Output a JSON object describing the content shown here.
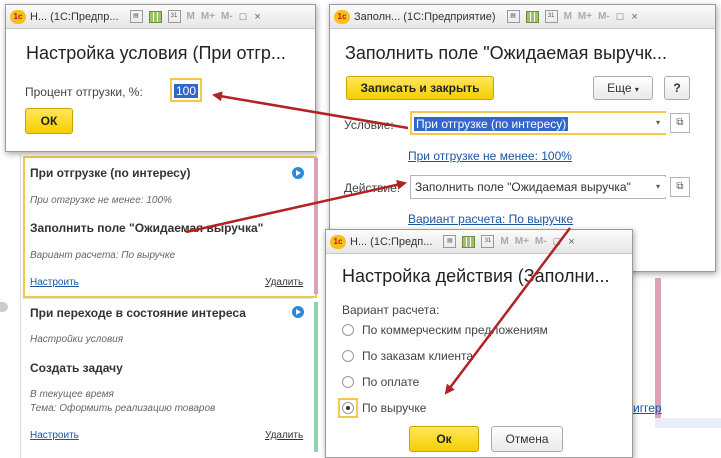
{
  "titlebar_glyphs": {
    "logo": "1c",
    "calendar_day": "31",
    "memory": "M",
    "memory_plus": "M+",
    "memory_minus": "M-",
    "maximize": "□",
    "close": "×"
  },
  "window_condition": {
    "title": "Н...  (1С:Предпр...",
    "heading": "Настройка условия (При отгр...",
    "percent_label": "Процент отгрузки, %:",
    "percent_value": "100",
    "ok_label": "ОК"
  },
  "window_fill": {
    "title": "Заполн... (1С:Предприятие)",
    "heading": "Заполнить  поле \"Ожидаемая  выручк...",
    "save_close_label": "Записать и закрыть",
    "more_label": "Еще",
    "help_label": "?",
    "condition_label": "Условие:",
    "condition_value": "При отгрузке (по интересу)",
    "condition_link": "При отгрузке не менее: 100%",
    "action_label": "Действие:",
    "action_value": "Заполнить  поле \"Ожидаемая  выручка\"",
    "variant_link": "Вариант расчета: По выручке"
  },
  "window_action": {
    "title": "Н... (1С:Предп...",
    "heading": "Настройка действия (Заполни...",
    "variant_label": "Вариант расчета:",
    "options": [
      "По коммерческим предложениям",
      "По заказам клиента",
      "По оплате",
      "По выручке"
    ],
    "selected_index": 3,
    "ok_label": "Ок",
    "cancel_label": "Отмена"
  },
  "panel": {
    "rule1": {
      "condition_title": "При отгрузке (по интересу)",
      "condition_detail": "При отгрузке не менее: 100%",
      "action_title": "Заполнить  поле \"Ожидаемая  выручка\"",
      "action_detail": "Вариант расчета: По выручке",
      "configure_link": "Настроить",
      "delete_link": "Удалить"
    },
    "rule2": {
      "condition_title": "При переходе в состояние интереса",
      "condition_detail": "Настройки условия",
      "action_title": "Создать задачу",
      "action_detail_1": "В текущее время",
      "action_detail_2": "Тема: Оформить реализацию товаров",
      "configure_link": "Настроить",
      "delete_link": "Удалить"
    }
  },
  "background_fragment": "иггер",
  "colors": {
    "accent_yellow": "#f4cf00",
    "link_blue": "#1a55a6",
    "highlight_border": "#f2c94c",
    "arrow_red": "#b22222",
    "selection_blue": "#3366cc"
  }
}
